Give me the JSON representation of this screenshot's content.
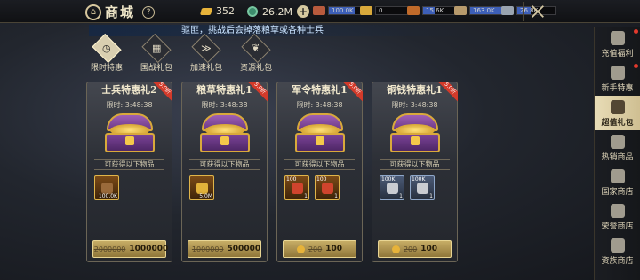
{
  "header": {
    "title": "商城",
    "help": "?",
    "gold": "352",
    "coins": "26.2M",
    "resources": [
      {
        "value": "100.0K",
        "fill": 0.7,
        "color": "#b85a3d"
      },
      {
        "value": "0",
        "fill": 0.0,
        "color": "#d9a93b"
      },
      {
        "value": "15.6K",
        "fill": 0.3,
        "color": "#c06a2a"
      },
      {
        "value": "163.0K",
        "fill": 0.85,
        "color": "#b79a6c"
      },
      {
        "value": "26.8K",
        "fill": 0.35,
        "color": "#9aa4b0"
      }
    ]
  },
  "marquee": "驱匪，挑战后会掉落粮草或各种士兵",
  "categories": [
    {
      "label": "限时特惠",
      "icon": "clock-icon"
    },
    {
      "label": "国战礼包",
      "icon": "grid-icon"
    },
    {
      "label": "加速礼包",
      "icon": "speed-icon"
    },
    {
      "label": "资源礼包",
      "icon": "leaf-icon"
    }
  ],
  "sidemenu": [
    {
      "label": "充值福利",
      "dot": true
    },
    {
      "label": "新手特惠",
      "dot": true
    },
    {
      "label": "超值礼包",
      "active": true
    },
    {
      "label": "热销商品"
    },
    {
      "label": "国家商店"
    },
    {
      "label": "荣誉商店"
    },
    {
      "label": "资族商店"
    }
  ],
  "gain_label": "可获得以下物品",
  "cards": [
    {
      "title": "士兵特惠礼2",
      "ribbon": "5.0折",
      "timer": "限时: 3:48:38",
      "items": [
        {
          "top": "",
          "count": "100.0K",
          "color": "#9a6a3a",
          "blue": false
        }
      ],
      "old_price": "2000000",
      "new_price": "1000000",
      "currency": "#5aa08a"
    },
    {
      "title": "粮草特惠礼1",
      "ribbon": "5.0折",
      "timer": "限时: 3:48:38",
      "items": [
        {
          "top": "",
          "count": "5.0M",
          "color": "#e2b23a",
          "blue": false
        }
      ],
      "old_price": "1000000",
      "new_price": "500000",
      "currency": "#5aa08a"
    },
    {
      "title": "军令特惠礼1",
      "ribbon": "5.0折",
      "timer": "限时: 3:48:38",
      "items": [
        {
          "top": "100",
          "count": "1",
          "color": "#d0442d",
          "blue": false
        },
        {
          "top": "100",
          "count": "1",
          "color": "#d0442d",
          "blue": false
        }
      ],
      "old_price": "200",
      "new_price": "100",
      "currency": "#e7b33a"
    },
    {
      "title": "铜钱特惠礼1",
      "ribbon": "5.0折",
      "timer": "限时: 3:48:38",
      "items": [
        {
          "top": "100K",
          "count": "1",
          "color": "#c9ccd2",
          "blue": true
        },
        {
          "top": "100K",
          "count": "1",
          "color": "#c9ccd2",
          "blue": true
        }
      ],
      "old_price": "200",
      "new_price": "100",
      "currency": "#e7b33a"
    }
  ]
}
